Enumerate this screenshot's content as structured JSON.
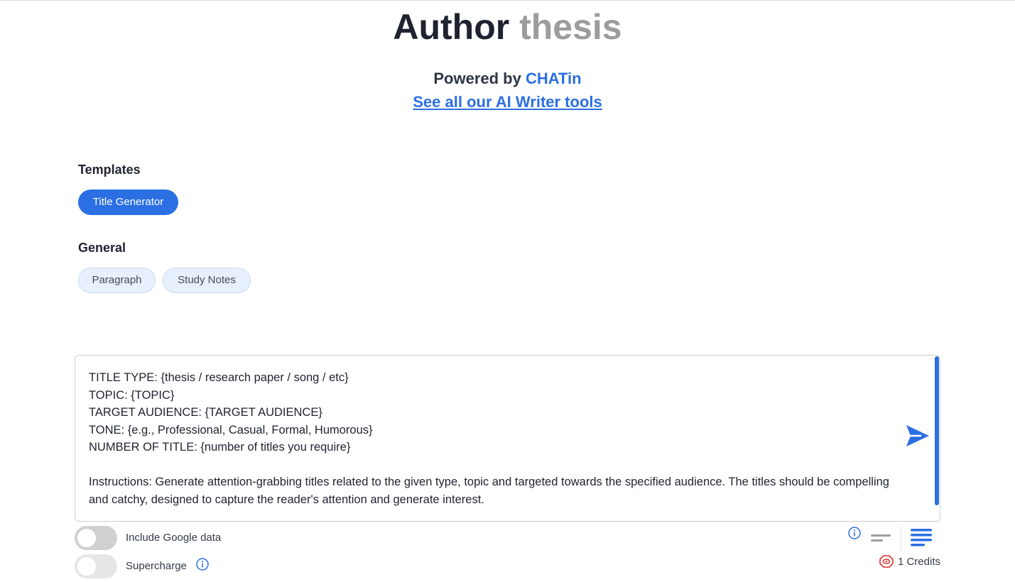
{
  "header": {
    "title_main": "Author",
    "title_accent": "thesis",
    "powered_prefix": "Powered by",
    "powered_brand": "CHATin",
    "tools_link": "See all our AI Writer tools"
  },
  "templates": {
    "label": "Templates",
    "items": [
      "Title Generator"
    ]
  },
  "general": {
    "label": "General",
    "items": [
      "Paragraph",
      "Study Notes"
    ]
  },
  "editor": {
    "lines": [
      "TITLE TYPE: {thesis / research paper / song / etc}",
      "TOPIC: {TOPIC}",
      "TARGET AUDIENCE: {TARGET AUDIENCE}",
      "TONE: {e.g., Professional, Casual, Formal, Humorous}",
      "NUMBER OF TITLE: {number of titles you require}"
    ],
    "instructions": "Instructions: Generate attention-grabbing titles related to the given type, topic and targeted towards the specified audience. The titles should be compelling and catchy, designed to capture the reader's attention and generate interest."
  },
  "options": {
    "google_data_label": "Include Google data",
    "google_data_enabled": false,
    "supercharge_label": "Supercharge",
    "supercharge_enabled": false
  },
  "footer": {
    "credits": "1 Credits"
  },
  "icons": {
    "send": "send-icon",
    "info": "info-icon",
    "credits": "credits-icon",
    "short_output": "short-lines-icon",
    "long_output": "long-lines-icon"
  },
  "colors": {
    "accent": "#2b6fe3",
    "muted_title": "#9c9c9c",
    "credits_icon": "#e03030"
  }
}
